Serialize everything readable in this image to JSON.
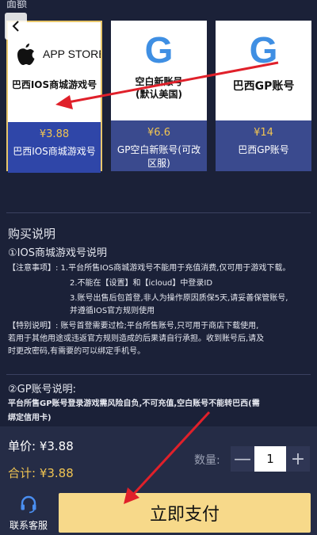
{
  "header": {
    "cut_label": "面额"
  },
  "products": [
    {
      "image_text": "APP STORE",
      "image_caption": "巴西IOS商城游戏号",
      "price": "¥3.88",
      "name": "巴西IOS商城游戏号"
    },
    {
      "image_text": "G",
      "image_caption_1": "空白新账号",
      "image_caption_2": "(默认美国)",
      "price": "¥6.6",
      "name": "GP空白新账号(可改区服)"
    },
    {
      "image_text": "G",
      "image_caption": "巴西GP账号",
      "price": "¥14",
      "name": "巴西GP账号"
    }
  ],
  "instructions": {
    "title": "购买说明",
    "ios_heading": "①IOS商城游戏号说明",
    "notes_line1": "【注意事项】: 1.平台所售IOS商城游戏号不能用于充值消费,仅可用于游戏下载。",
    "notes_line2": "2.不能在【设置】和【icloud】中登录ID",
    "notes_line3": "3.账号出售后包首登,非人为操作原因质保5天,请妥善保管账号,",
    "notes_line4": "并遵循IOS官方规则使用",
    "special_line1": "【特别说明】: 账号首登需要过检;平台所售账号,只可用于商店下载使用,",
    "special_line2": "若用于其他用途或违返官方规则造成的后果请自行承担。收到账号后,请及",
    "special_line3": "时更改密码,有需要的可以绑定手机号。",
    "gp_heading": "②GP账号说明:",
    "gp_line1": "平台所售GP账号登录游戏需风险自负,不可充值,空白账号不能转巴西(需",
    "gp_line2": "绑定信用卡)"
  },
  "footer": {
    "unit_price": "单价: ¥3.88",
    "total": "合计: ¥3.88",
    "quantity_label": "数量:",
    "quantity_value": "1",
    "minus": "—",
    "plus": "+",
    "support_label": "联系客服",
    "pay_label": "立即支付"
  },
  "colors": {
    "background": "#1b2138",
    "card_info": "#3a4a8e",
    "accent_gold": "#f0c452",
    "pay_button": "#f7d98a",
    "annotation": "#e0202a"
  },
  "icons": [
    "back-arrow-icon",
    "apple-icon",
    "google-g-icon",
    "headset-icon"
  ]
}
